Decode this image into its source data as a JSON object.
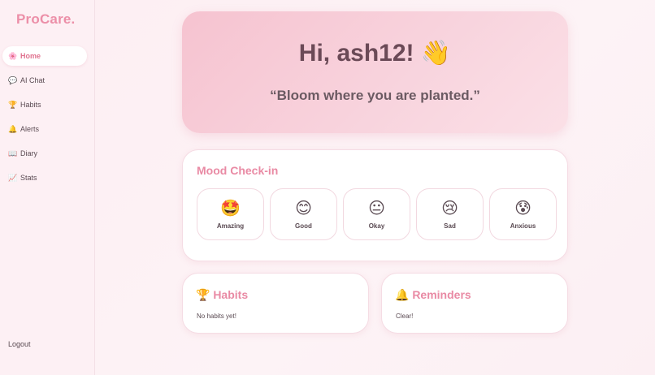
{
  "app": {
    "brand": "ProCare."
  },
  "sidebar": {
    "items": [
      {
        "icon": "🌸",
        "label": "Home",
        "active": true
      },
      {
        "icon": "💬",
        "label": "AI Chat"
      },
      {
        "icon": "🏆",
        "label": "Habits"
      },
      {
        "icon": "🔔",
        "label": "Alerts"
      },
      {
        "icon": "📖",
        "label": "Diary"
      },
      {
        "icon": "📈",
        "label": "Stats"
      }
    ],
    "logout": "Logout"
  },
  "hero": {
    "greeting": "Hi, ash12! 👋",
    "quote": "“Bloom where you are planted.”"
  },
  "mood": {
    "title": "Mood Check-in",
    "options": [
      {
        "emoji": "🤩",
        "label": "Amazing"
      },
      {
        "emoji": "😊",
        "label": "Good"
      },
      {
        "emoji": "😐",
        "label": "Okay"
      },
      {
        "emoji": "😢",
        "label": "Sad"
      },
      {
        "emoji": "😰",
        "label": "Anxious"
      }
    ]
  },
  "habits": {
    "title": "🏆 Habits",
    "empty_text": "No habits yet!"
  },
  "reminders": {
    "title": "🔔 Reminders",
    "empty_text": "Clear!"
  },
  "colors": {
    "accent": "#e98aa4",
    "hero_bg": "#f6c3d0",
    "text": "#5a4a52"
  }
}
